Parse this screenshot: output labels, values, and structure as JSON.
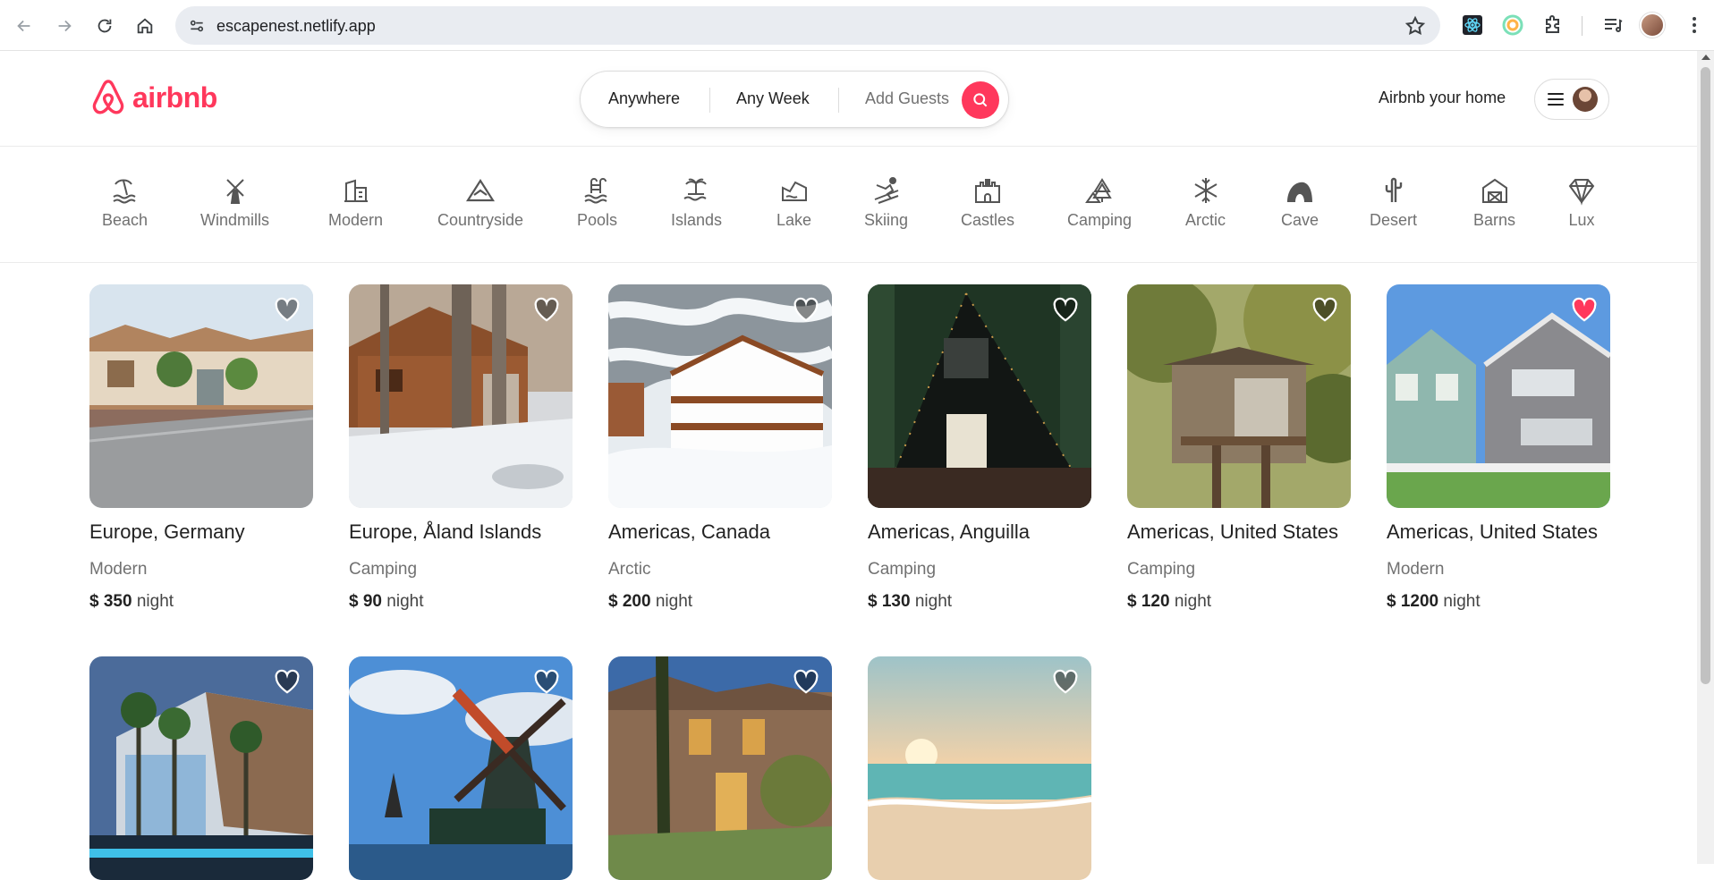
{
  "browser": {
    "url": "escapenest.netlify.app"
  },
  "header": {
    "logo_text": "airbnb",
    "search": {
      "where": "Anywhere",
      "when": "Any Week",
      "guests": "Add Guests"
    },
    "host_link": "Airbnb your home"
  },
  "categories": [
    {
      "label": "Beach",
      "icon": "beach-icon"
    },
    {
      "label": "Windmills",
      "icon": "windmill-icon"
    },
    {
      "label": "Modern",
      "icon": "modern-building-icon"
    },
    {
      "label": "Countryside",
      "icon": "mountain-icon"
    },
    {
      "label": "Pools",
      "icon": "pool-icon"
    },
    {
      "label": "Islands",
      "icon": "island-icon"
    },
    {
      "label": "Lake",
      "icon": "lake-icon"
    },
    {
      "label": "Skiing",
      "icon": "skiing-icon"
    },
    {
      "label": "Castles",
      "icon": "castle-icon"
    },
    {
      "label": "Camping",
      "icon": "camping-icon"
    },
    {
      "label": "Arctic",
      "icon": "snowflake-icon"
    },
    {
      "label": "Cave",
      "icon": "cave-icon"
    },
    {
      "label": "Desert",
      "icon": "cactus-icon"
    },
    {
      "label": "Barns",
      "icon": "barn-icon"
    },
    {
      "label": "Lux",
      "icon": "diamond-icon"
    }
  ],
  "listings": [
    {
      "location": "Europe, Germany",
      "category": "Modern",
      "currency": "$",
      "price": "350",
      "unit": "night",
      "favorited": false
    },
    {
      "location": "Europe, Åland Islands",
      "category": "Camping",
      "currency": "$",
      "price": "90",
      "unit": "night",
      "favorited": false
    },
    {
      "location": "Americas, Canada",
      "category": "Arctic",
      "currency": "$",
      "price": "200",
      "unit": "night",
      "favorited": false
    },
    {
      "location": "Americas, Anguilla",
      "category": "Camping",
      "currency": "$",
      "price": "130",
      "unit": "night",
      "favorited": false
    },
    {
      "location": "Americas, United States",
      "category": "Camping",
      "currency": "$",
      "price": "120",
      "unit": "night",
      "favorited": false
    },
    {
      "location": "Americas, United States",
      "category": "Modern",
      "currency": "$",
      "price": "1200",
      "unit": "night",
      "favorited": true
    },
    {
      "favorited": false
    },
    {
      "favorited": false
    },
    {
      "favorited": false
    },
    {
      "favorited": false
    }
  ],
  "colors": {
    "brand": "#ff385c",
    "heart_default": "rgba(0,0,0,0.45)",
    "heart_active": "#ff385c"
  }
}
